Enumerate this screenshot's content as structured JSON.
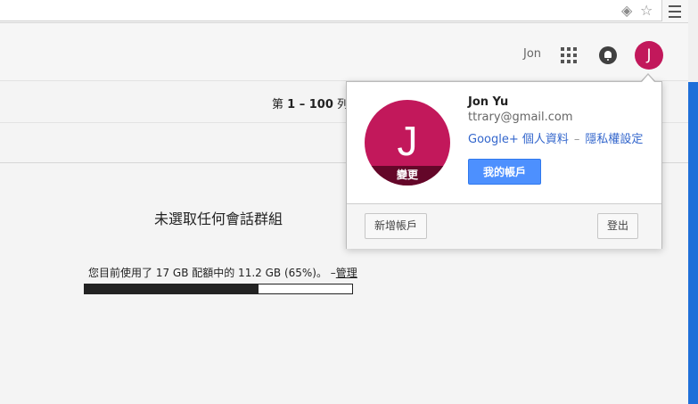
{
  "header": {
    "user_name": "Jon",
    "avatar_letter": "J"
  },
  "toolbar": {
    "pager_prefix": "第",
    "pager_range": "1 – 100",
    "pager_suffix": "列"
  },
  "main": {
    "empty_message": "未選取任何會話群組",
    "storage_text": "您目前使用了 17 GB 配額中的 11.2 GB (65%)。 –",
    "storage_manage": "管理",
    "storage_percent": 65
  },
  "account_popup": {
    "avatar_letter": "J",
    "change_label": "變更",
    "name": "Jon Yu",
    "email": "ttrary@gmail.com",
    "profile_link": "Google+ 個人資料",
    "separator": "–",
    "privacy_link": "隱私權設定",
    "my_account_button": "我的帳戶",
    "add_account_button": "新增帳戶",
    "sign_out_button": "登出"
  },
  "colors": {
    "avatar": "#c2185b",
    "primary_button": "#4d90fe",
    "link": "#3366cc"
  }
}
